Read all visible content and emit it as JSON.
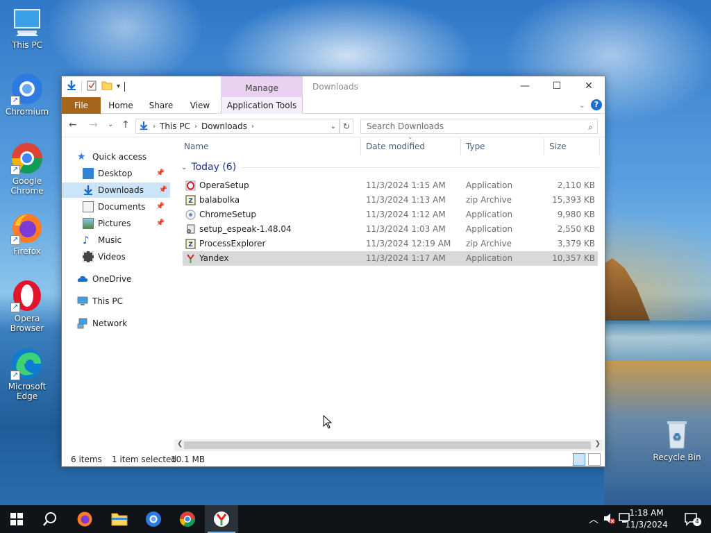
{
  "desktop": {
    "icons": [
      {
        "label": "This PC"
      },
      {
        "label": "Chromium"
      },
      {
        "label": "Google Chrome"
      },
      {
        "label": "Firefox"
      },
      {
        "label": "Opera Browser"
      },
      {
        "label": "Microsoft Edge"
      },
      {
        "label": "Recycle Bin"
      }
    ]
  },
  "window": {
    "title": "Downloads",
    "manage_tab": "Manage",
    "ribbon": {
      "file": "File",
      "home": "Home",
      "share": "Share",
      "view": "View",
      "app_tools": "Application Tools"
    },
    "address": {
      "crumbs": [
        "This PC",
        "Downloads"
      ]
    },
    "search": {
      "placeholder": "Search Downloads"
    },
    "nav": [
      {
        "label": "Quick access"
      },
      {
        "label": "Desktop"
      },
      {
        "label": "Downloads"
      },
      {
        "label": "Documents"
      },
      {
        "label": "Pictures"
      },
      {
        "label": "Music"
      },
      {
        "label": "Videos"
      },
      {
        "label": "OneDrive"
      },
      {
        "label": "This PC"
      },
      {
        "label": "Network"
      }
    ],
    "columns": {
      "name": "Name",
      "date": "Date modified",
      "type": "Type",
      "size": "Size"
    },
    "group": "Today (6)",
    "files": [
      {
        "name": "OperaSetup",
        "date": "11/3/2024 1:15 AM",
        "type": "Application",
        "size": "2,110 KB"
      },
      {
        "name": "balabolka",
        "date": "11/3/2024 1:13 AM",
        "type": "zip Archive",
        "size": "15,393 KB"
      },
      {
        "name": "ChromeSetup",
        "date": "11/3/2024 1:12 AM",
        "type": "Application",
        "size": "9,980 KB"
      },
      {
        "name": "setup_espeak-1.48.04",
        "date": "11/3/2024 1:03 AM",
        "type": "Application",
        "size": "2,550 KB"
      },
      {
        "name": "ProcessExplorer",
        "date": "11/3/2024 12:19 AM",
        "type": "zip Archive",
        "size": "3,379 KB"
      },
      {
        "name": "Yandex",
        "date": "11/3/2024 1:17 AM",
        "type": "Application",
        "size": "10,357 KB"
      }
    ],
    "status": {
      "items": "6 items",
      "selected": "1 item selected",
      "size": "10.1 MB"
    }
  },
  "taskbar": {
    "time": "1:18 AM",
    "date": "11/3/2024",
    "notifications": "4"
  },
  "colors": {
    "file_tab": "#a5651d",
    "manage_tab": "#e8d2f0",
    "selection": "#cce4f7",
    "taskbar": "#101418"
  }
}
